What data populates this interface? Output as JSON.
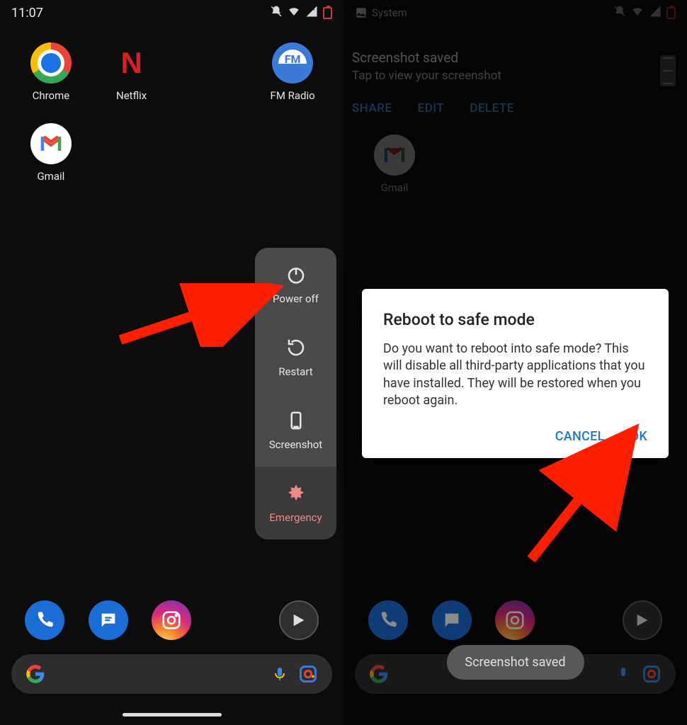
{
  "left": {
    "statusbar": {
      "time": "11:07"
    },
    "apps": {
      "chrome": "Chrome",
      "netflix": "Netflix",
      "fmradio": "FM Radio",
      "gmail": "Gmail"
    },
    "power_menu": {
      "power_off": "Power off",
      "restart": "Restart",
      "screenshot": "Screenshot",
      "emergency": "Emergency"
    }
  },
  "right": {
    "statusbar": {
      "app": "System"
    },
    "notification": {
      "title": "Screenshot saved",
      "subtitle": "Tap to view your screenshot",
      "actions": {
        "share": "SHARE",
        "edit": "EDIT",
        "delete": "DELETE"
      }
    },
    "apps": {
      "gmail": "Gmail"
    },
    "dialog": {
      "title": "Reboot to safe mode",
      "body": "Do you want to reboot into safe mode? This will disable all third-party applications that you have installed. They will be restored when you reboot again.",
      "cancel": "CANCEL",
      "ok": "OK"
    },
    "toast": "Screenshot saved"
  }
}
